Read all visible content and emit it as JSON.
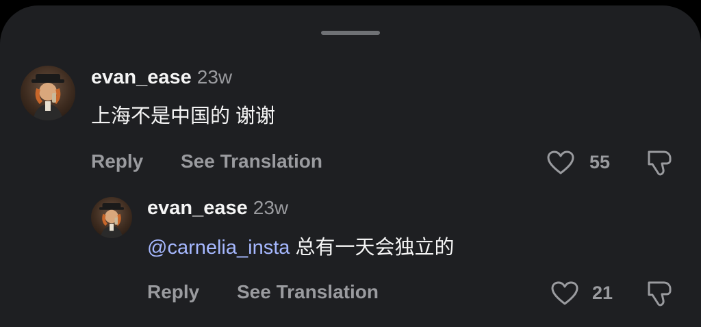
{
  "comments": [
    {
      "username": "evan_ease",
      "time": "23w",
      "text": "上海不是中国的 谢谢",
      "reply_label": "Reply",
      "translate_label": "See Translation",
      "like_count": "55"
    },
    {
      "username": "evan_ease",
      "time": "23w",
      "mention": "@carnelia_insta",
      "text": " 总有一天会独立的",
      "reply_label": "Reply",
      "translate_label": "See Translation",
      "like_count": "21"
    }
  ],
  "icons": [
    "heart-icon",
    "thumbs-down-icon"
  ],
  "colors": {
    "background": "#1e1f22",
    "text": "#f5f5f5",
    "muted": "#9a9b9f",
    "mention": "#a6b8ff"
  }
}
